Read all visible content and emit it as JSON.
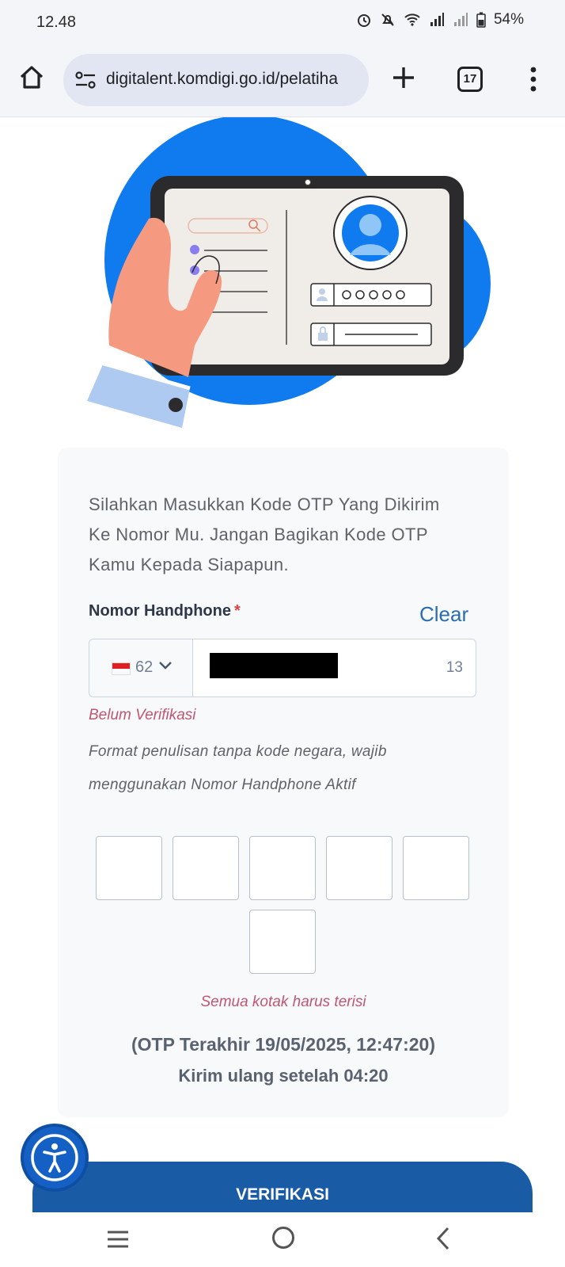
{
  "status_bar": {
    "time": "12.48",
    "battery": "54%",
    "icons": [
      "alarm-icon",
      "mute-icon",
      "wifi-icon",
      "signal-icon",
      "signal-icon",
      "battery-icon"
    ]
  },
  "browser": {
    "url": "digitalent.komdigi.go.id/pelatiha",
    "tab_count": "17"
  },
  "form": {
    "intro": "Silahkan Masukkan Kode OTP Yang Dikirim Ke Nomor Mu. Jangan Bagikan Kode OTP Kamu Kepada Siapapun.",
    "phone_label": "Nomor Handphone",
    "required_mark": "*",
    "clear_label": "Clear",
    "country_code": "62",
    "char_count": "13",
    "verification_status": "Belum Verifikasi",
    "help_text": "Format penulisan tanpa kode negara, wajib menggunakan Nomor Handphone Aktif",
    "otp_error": "Semua kotak harus terisi",
    "otp_last": "(OTP Terakhir 19/05/2025, 12:47:20)",
    "resend_text": "Kirim ulang setelah 04:20",
    "verify_button": "VERIFIKASI"
  },
  "colors": {
    "primary": "#1a5ba6",
    "link": "#2b6cb0",
    "error": "#c05670",
    "hero_blue": "#0f7bef"
  }
}
